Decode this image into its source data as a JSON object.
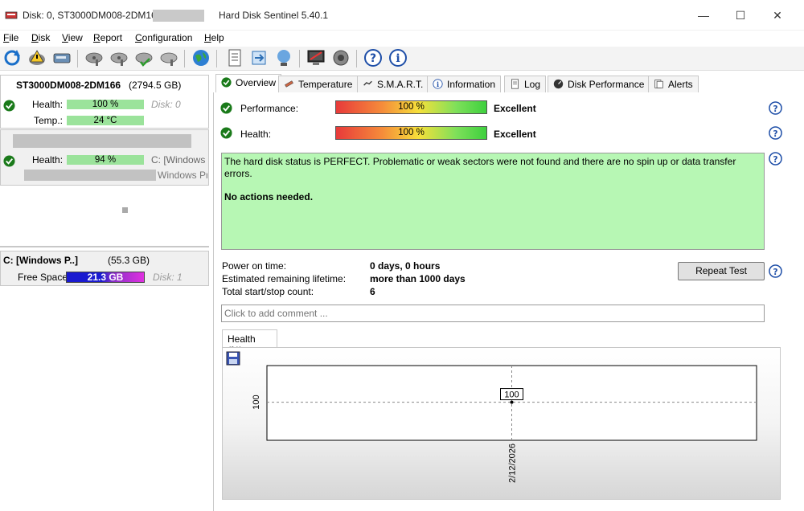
{
  "window": {
    "title": "Disk: 0, ST3000DM008-2DM166",
    "app": "Hard Disk Sentinel 5.40.1",
    "minimize": "—",
    "maximize": "☐",
    "close": "✕"
  },
  "menu": [
    {
      "key": "F",
      "rest": "ile"
    },
    {
      "key": "D",
      "rest": "isk"
    },
    {
      "key": "V",
      "rest": "iew"
    },
    {
      "key": "R",
      "rest": "eport"
    },
    {
      "key": "C",
      "rest": "onfiguration"
    },
    {
      "key": "H",
      "rest": "elp"
    }
  ],
  "left": {
    "disk1": {
      "name": "ST3000DM008-2DM166",
      "size": "(2794.5 GB)",
      "health_label": "Health:",
      "health_value": "100 %",
      "disk_label": "Disk: 0",
      "temp_label": "Temp.:",
      "temp_value": "24 °C"
    },
    "disk2": {
      "health_label": "Health:",
      "health_value": "94 %",
      "partition": "C: [Windows I",
      "partition2": "Windows Pr"
    },
    "volume": {
      "name": "C: [Windows P..]",
      "size": "(55.3 GB)",
      "free_label": "Free Space",
      "free_value": "21.3 GB",
      "disk_label": "Disk: 1"
    }
  },
  "tabs": [
    "Overview",
    "Temperature",
    "S.M.A.R.T.",
    "Information",
    "Log",
    "Disk Performance",
    "Alerts"
  ],
  "overview": {
    "performance_label": "Performance:",
    "performance_value": "100 %",
    "performance_rating": "Excellent",
    "health_label": "Health:",
    "health_value": "100 %",
    "health_rating": "Excellent",
    "status_text": "The hard disk status is PERFECT. Problematic or weak sectors were not found and there are no spin up or data transfer errors.",
    "status_action": "No actions needed.",
    "power_on_label": "Power on time:",
    "power_on_value": "0 days, 0 hours",
    "lifetime_label": "Estimated remaining lifetime:",
    "lifetime_value": "more than 1000 days",
    "startstop_label": "Total start/stop count:",
    "startstop_value": "6",
    "repeat_test": "Repeat Test",
    "comment_placeholder": "Click to add comment ..."
  },
  "chart_data": {
    "type": "line",
    "tab_label": "Health (%)",
    "x": [
      "2/12/2026"
    ],
    "series": [
      {
        "values": [
          100
        ]
      }
    ],
    "y_tick": "100",
    "point_label": "100",
    "grid": true
  },
  "colors": {
    "status_bg": "#b7f7b4",
    "bar_green": "#9be39b",
    "free_space": "#1a1ad0"
  }
}
